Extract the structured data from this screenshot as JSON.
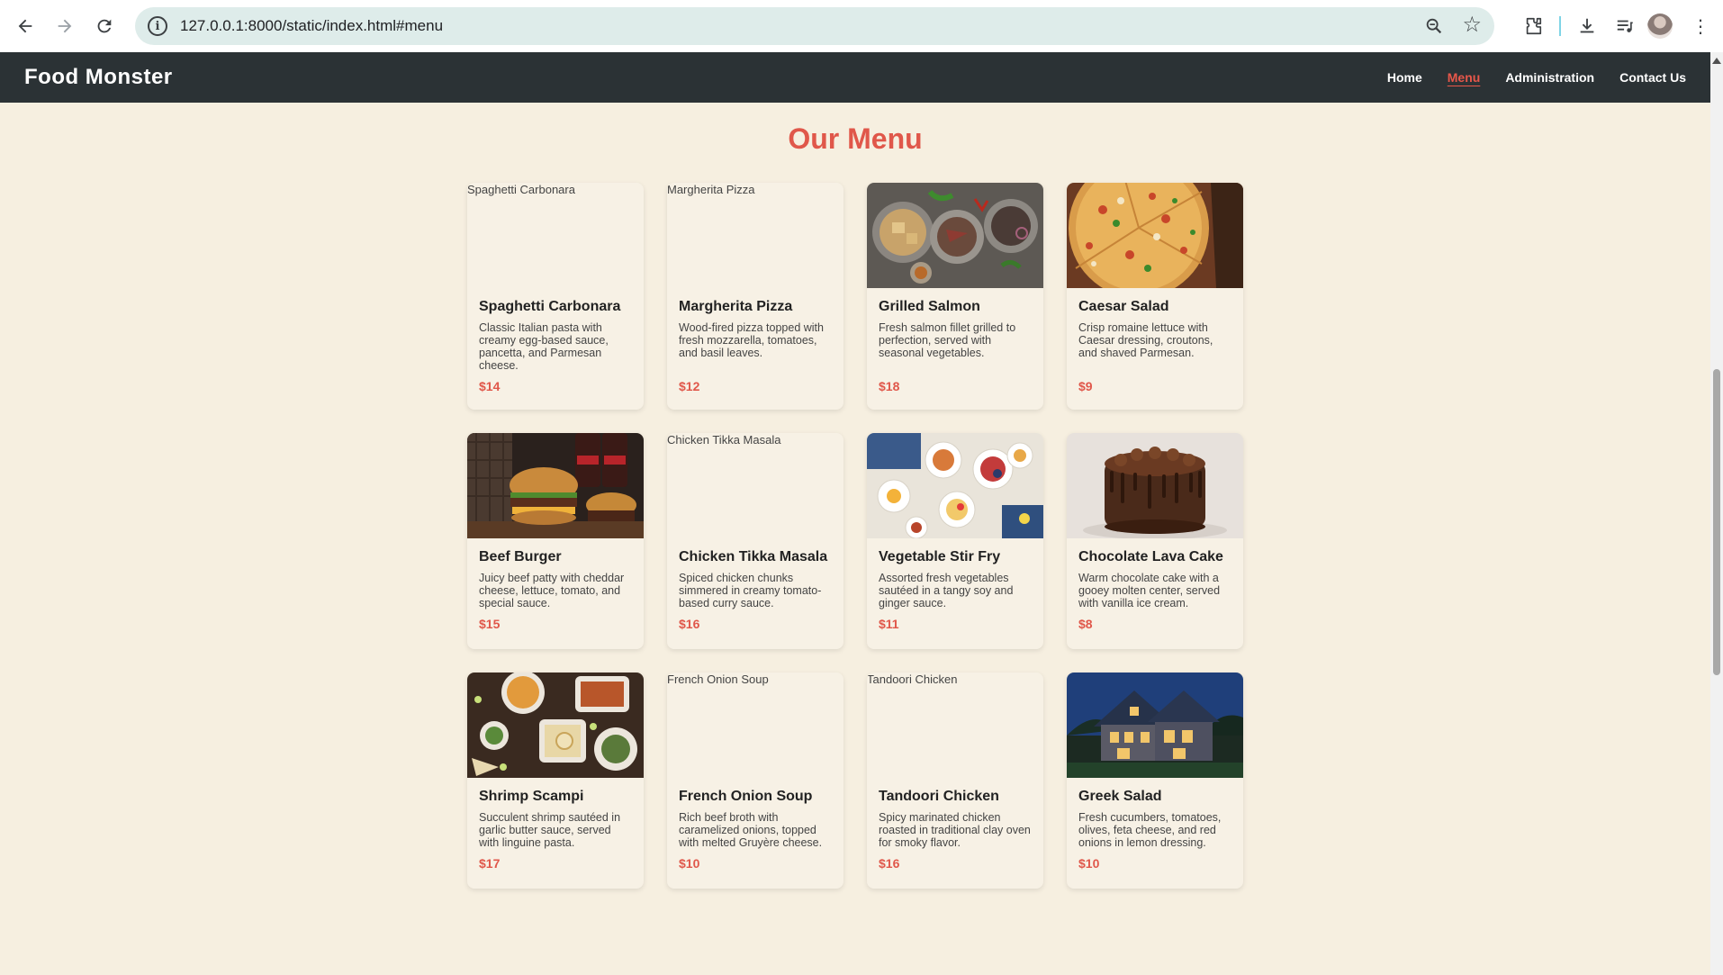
{
  "browser": {
    "url": "127.0.0.1:8000/static/index.html#menu"
  },
  "site": {
    "brand": "Food Monster",
    "nav": [
      {
        "label": "Home",
        "active": false
      },
      {
        "label": "Menu",
        "active": true
      },
      {
        "label": "Administration",
        "active": false
      },
      {
        "label": "Contact Us",
        "active": false
      }
    ]
  },
  "menu": {
    "title": "Our Menu",
    "items": [
      {
        "name": "Spaghetti Carbonara",
        "description": "Classic Italian pasta with creamy egg-based sauce, pancetta, and Parmesan cheese.",
        "price": "$14",
        "image_alt": "Spaghetti Carbonara",
        "image": "broken"
      },
      {
        "name": "Margherita Pizza",
        "description": "Wood-fired pizza topped with fresh mozzarella, tomatoes, and basil leaves.",
        "price": "$12",
        "image_alt": "Margherita Pizza",
        "image": "broken"
      },
      {
        "name": "Grilled Salmon",
        "description": "Fresh salmon fillet grilled to perfection, served with seasonal vegetables.",
        "price": "$18",
        "image_alt": "Grilled Salmon",
        "image": "plates-photo"
      },
      {
        "name": "Caesar Salad",
        "description": "Crisp romaine lettuce with Caesar dressing, croutons, and shaved Parmesan.",
        "price": "$9",
        "image_alt": "Caesar Salad",
        "image": "pizza-photo"
      },
      {
        "name": "Beef Burger",
        "description": "Juicy beef patty with cheddar cheese, lettuce, tomato, and special sauce.",
        "price": "$15",
        "image_alt": "Beef Burger",
        "image": "burger-photo"
      },
      {
        "name": "Chicken Tikka Masala",
        "description": "Spiced chicken chunks simmered in creamy tomato-based curry sauce.",
        "price": "$16",
        "image_alt": "Chicken Tikka Masala",
        "image": "broken"
      },
      {
        "name": "Vegetable Stir Fry",
        "description": "Assorted fresh vegetables sautéed in a tangy soy and ginger sauce.",
        "price": "$11",
        "image_alt": "Vegetable Stir Fry",
        "image": "breakfast-photo"
      },
      {
        "name": "Chocolate Lava Cake",
        "description": "Warm chocolate cake with a gooey molten center, served with vanilla ice cream.",
        "price": "$8",
        "image_alt": "Chocolate Lava Cake",
        "image": "cake-photo"
      },
      {
        "name": "Shrimp Scampi",
        "description": "Succulent shrimp sautéed in garlic butter sauce, served with linguine pasta.",
        "price": "$17",
        "image_alt": "Shrimp Scampi",
        "image": "table-spread-photo"
      },
      {
        "name": "French Onion Soup",
        "description": "Rich beef broth with caramelized onions, topped with melted Gruyère cheese.",
        "price": "$10",
        "image_alt": "French Onion Soup",
        "image": "broken"
      },
      {
        "name": "Tandoori Chicken",
        "description": "Spicy marinated chicken roasted in traditional clay oven for smoky flavor.",
        "price": "$16",
        "image_alt": "Tandoori Chicken",
        "image": "broken"
      },
      {
        "name": "Greek Salad",
        "description": "Fresh cucumbers, tomatoes, olives, feta cheese, and red onions in lemon dressing.",
        "price": "$10",
        "image_alt": "Greek Salad",
        "image": "house-photo"
      }
    ]
  },
  "colors": {
    "page_bg": "#f6efe0",
    "header_bg": "#2b3235",
    "accent": "#e0574a"
  }
}
